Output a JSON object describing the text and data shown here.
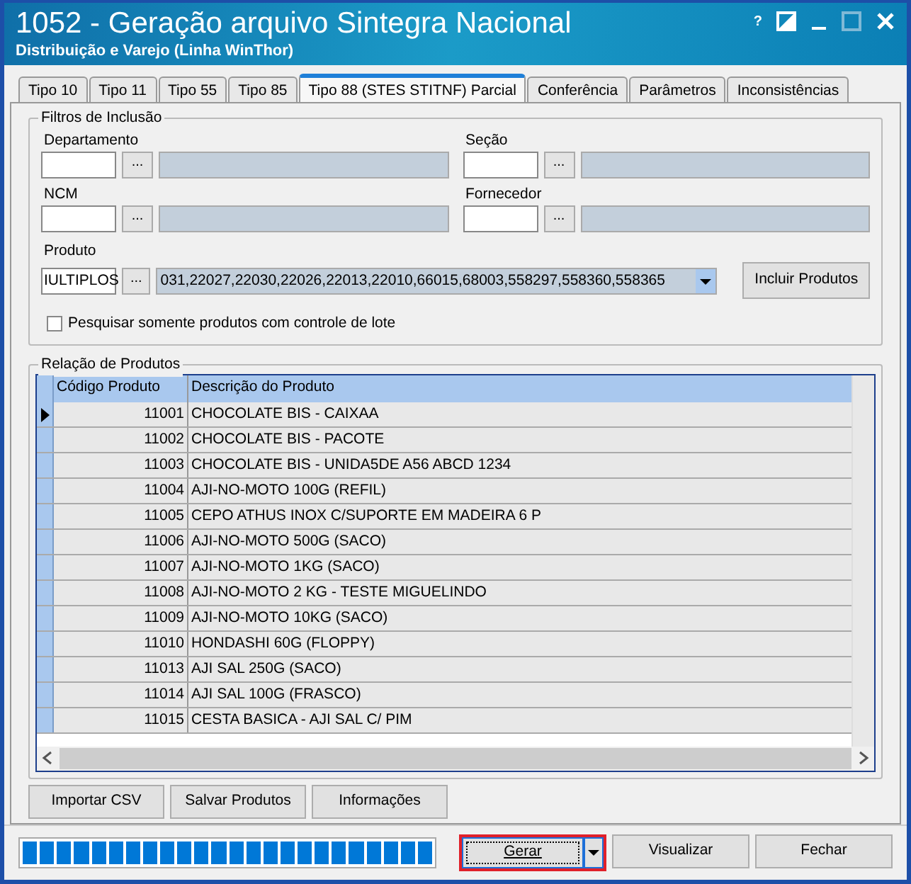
{
  "window": {
    "title": "1052 - Geração arquivo Sintegra Nacional",
    "subtitle": "Distribuição e Varejo (Linha WinThor)",
    "controls": [
      "?"
    ]
  },
  "tabs": [
    {
      "label": "Tipo 10",
      "selected": false
    },
    {
      "label": "Tipo 11",
      "selected": false
    },
    {
      "label": "Tipo 55",
      "selected": false
    },
    {
      "label": "Tipo 85",
      "selected": false
    },
    {
      "label": "Tipo 88 (STES STITNF) Parcial",
      "selected": true
    },
    {
      "label": "Conferência",
      "selected": false
    },
    {
      "label": "Parâmetros",
      "selected": false
    },
    {
      "label": "Inconsistências",
      "selected": false
    }
  ],
  "filters": {
    "title": "Filtros de Inclusão",
    "fields": [
      {
        "label": "Departamento",
        "lookup": "..."
      },
      {
        "label": "Seção",
        "lookup": "..."
      },
      {
        "label": "NCM",
        "lookup": "..."
      },
      {
        "label": "Fornecedor",
        "lookup": "..."
      }
    ],
    "product": {
      "label": "Produto",
      "value": "IULTIPLOS",
      "lookup": "...",
      "list": "031,22027,22030,22026,22013,22010,66015,68003,558297,558360,558365"
    },
    "include_button": "Incluir Produtos",
    "lot_only": {
      "label": "Pesquisar somente produtos com controle de lote",
      "checked": false
    }
  },
  "products": {
    "title": "Relação de Produtos",
    "columns": [
      "Código Produto",
      "Descrição do Produto"
    ],
    "rows": [
      {
        "code": "11001",
        "description": "CHOCOLATE BIS  - CAIXAA",
        "selected": true
      },
      {
        "code": "11002",
        "description": "CHOCOLATE BIS - PACOTE",
        "selected": false
      },
      {
        "code": "11003",
        "description": "CHOCOLATE BIS - UNIDA5DE A56 ABCD 1234",
        "selected": false
      },
      {
        "code": "11004",
        "description": "AJI-NO-MOTO 100G (REFIL)",
        "selected": false
      },
      {
        "code": "11005",
        "description": "CEPO ATHUS INOX C/SUPORTE EM MADEIRA 6 P",
        "selected": false
      },
      {
        "code": "11006",
        "description": "AJI-NO-MOTO 500G (SACO)",
        "selected": false
      },
      {
        "code": "11007",
        "description": "AJI-NO-MOTO 1KG (SACO)",
        "selected": false
      },
      {
        "code": "11008",
        "description": "AJI-NO-MOTO 2 KG - TESTE MIGUELINDO",
        "selected": false
      },
      {
        "code": "11009",
        "description": "AJI-NO-MOTO 10KG (SACO)",
        "selected": false
      },
      {
        "code": "11010",
        "description": "HONDASHI 60G (FLOPPY)",
        "selected": false
      },
      {
        "code": "11013",
        "description": "AJI SAL 250G (SACO)",
        "selected": false
      },
      {
        "code": "11014",
        "description": "AJI SAL 100G (FRASCO)",
        "selected": false
      },
      {
        "code": "11015",
        "description": "CESTA BASICA - AJI SAL C/ PIM",
        "selected": false
      }
    ],
    "buttons": [
      "Importar CSV",
      "Salvar Produtos",
      "Informações"
    ]
  },
  "progress": {
    "level": 1
  },
  "actions": [
    {
      "label": "Gerar",
      "kind": "split",
      "highlighted": true
    },
    {
      "label": "Visualizar",
      "kind": "plain",
      "highlighted": false
    },
    {
      "label": "Fechar",
      "kind": "plain",
      "highlighted": false
    }
  ]
}
